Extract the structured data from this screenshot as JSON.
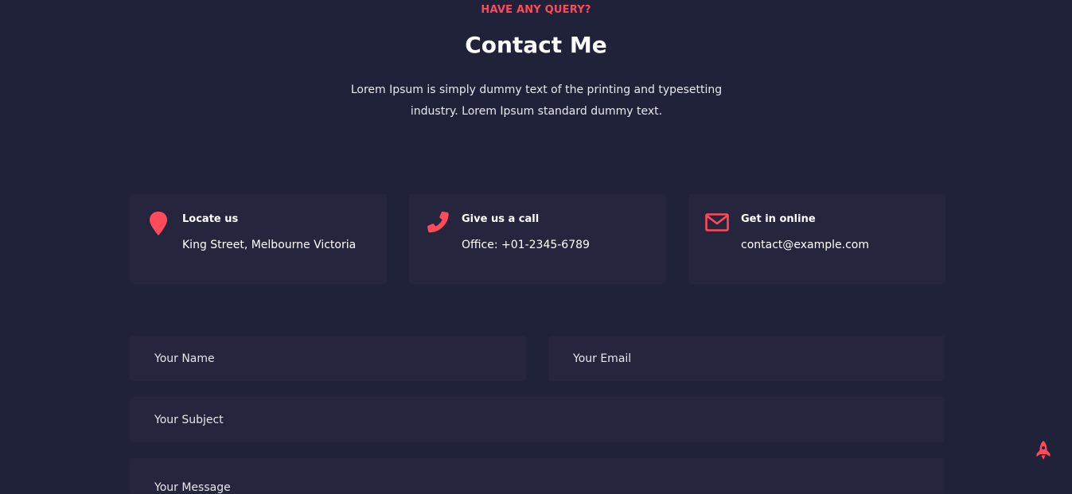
{
  "header": {
    "tag": "HAVE ANY QUERY?",
    "title": "Contact Me",
    "description": "Lorem Ipsum is simply dummy text of the printing and typesetting industry. Lorem Ipsum standard dummy text."
  },
  "cards": [
    {
      "icon": "map-marker-icon",
      "title": "Locate us",
      "value": "King Street, Melbourne Victoria"
    },
    {
      "icon": "phone-icon",
      "title": "Give us a call",
      "value": "Office: +01-2345-6789"
    },
    {
      "icon": "envelope-icon",
      "title": "Get in online",
      "value": "contact@example.com"
    }
  ],
  "form": {
    "name_placeholder": "Your Name",
    "email_placeholder": "Your Email",
    "subject_placeholder": "Your Subject",
    "message_placeholder": "Your Message"
  },
  "scroll_top": {
    "icon": "rocket-icon"
  },
  "colors": {
    "background": "#20223a",
    "card_background": "#25263d",
    "accent": "#ff4a5a",
    "text": "#ffffff"
  }
}
